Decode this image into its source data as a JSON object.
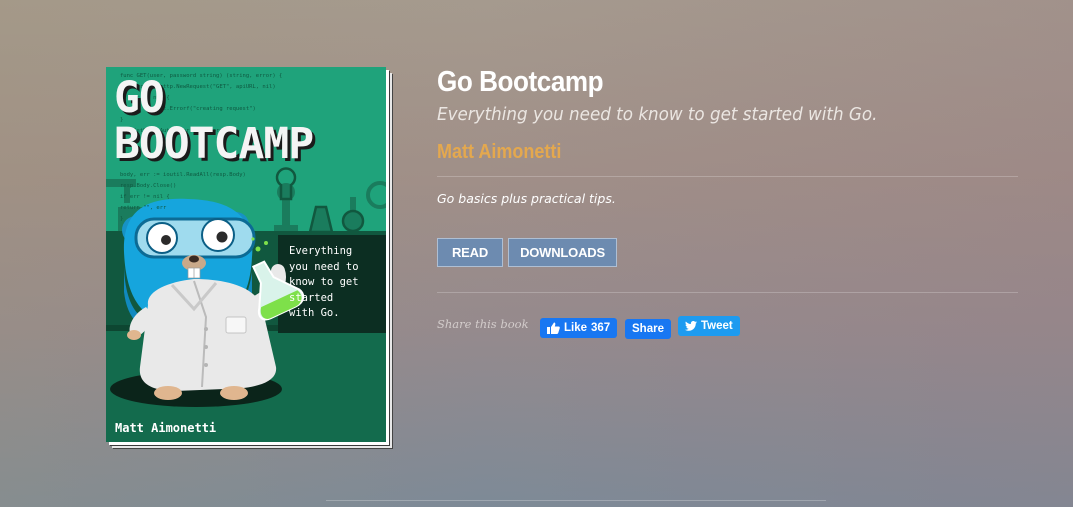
{
  "book": {
    "title": "Go Bootcamp",
    "subtitle": "Everything you need to know to get started with Go.",
    "author": "Matt Aimonetti",
    "description": "Go basics plus practical tips."
  },
  "cover": {
    "title": "GO\nBOOTCAMP",
    "blurb": "Everything\n you need to\n  know to get\n started\nwith Go.",
    "author": "Matt Aimonetti",
    "code_lines": [
      "func GET(user, password string) (string, error) {",
      "  req, err := http.NewRequest(\"GET\", apiURL, nil)",
      "  if err != nil {",
      "    return \"\", fmt.Errorf(\"creating request\")",
      "  }",
      "  req.SetBasicAuth(user, password)",
      "",
      "",
      "",
      "  body, err := ioutil.ReadAll(resp.Body)",
      "  resp.Body.Close()",
      "  if err != nil {",
      "    return \"\", err",
      "  }"
    ]
  },
  "actions": {
    "read_label": "READ",
    "downloads_label": "DOWNLOADS"
  },
  "share": {
    "label": "Share this book",
    "like_label": "Like",
    "like_count": "367",
    "share_label": "Share",
    "tweet_label": "Tweet"
  },
  "colors": {
    "cover_green": "#1fa37b",
    "author_accent": "#e4a84e",
    "button_bg": "#6d8bb0",
    "facebook_blue": "#1877f2",
    "twitter_blue": "#1d9bf0"
  },
  "icons": [
    "thumbs-up-icon",
    "twitter-bird-icon",
    "gopher-illustration",
    "flask-icon",
    "microscope-icon"
  ]
}
